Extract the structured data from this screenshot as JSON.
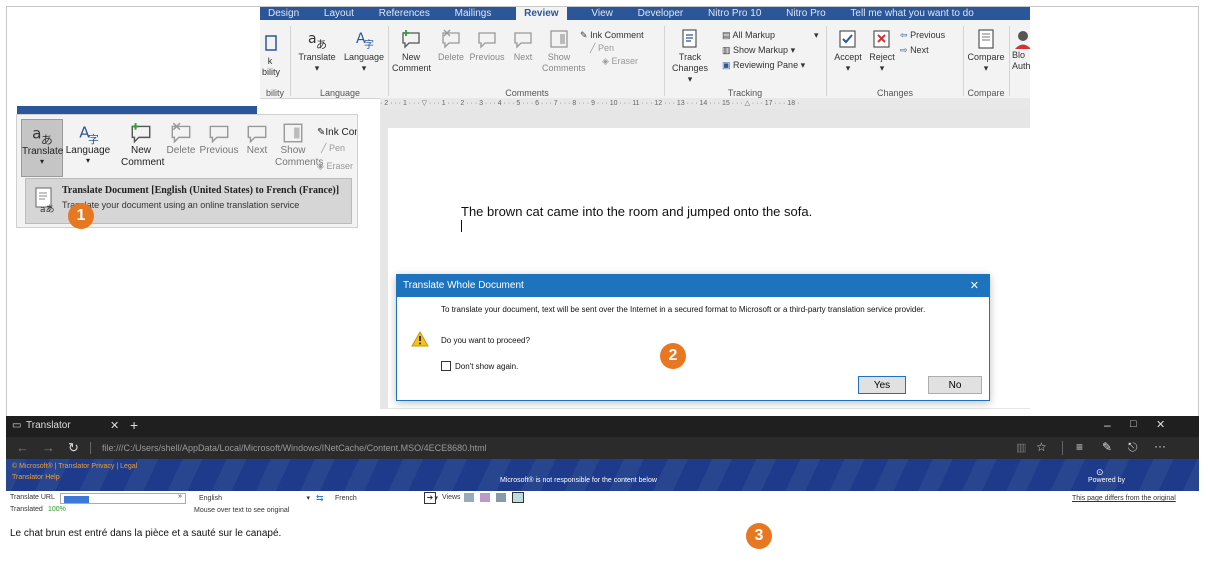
{
  "word": {
    "tabs": [
      "Design",
      "Layout",
      "References",
      "Mailings",
      "Review",
      "View",
      "Developer",
      "Nitro Pro 10",
      "Nitro Pro",
      "Tell me what you want to do"
    ],
    "active_tab": "Review",
    "ribbon": {
      "partial_left_top": "k",
      "partial_left_mid": "bility",
      "partial_left_group": "bility",
      "translate": "Translate",
      "language": "Language",
      "language_group": "Language",
      "new_comment_1": "New",
      "new_comment_2": "Comment",
      "delete": "Delete",
      "previous": "Previous",
      "next": "Next",
      "show_comments_1": "Show",
      "show_comments_2": "Comments",
      "ink_comment": "Ink Comment",
      "pen": "Pen",
      "eraser": "Eraser",
      "comments_group": "Comments",
      "track_changes_1": "Track",
      "track_changes_2": "Changes",
      "all_markup": "All Markup",
      "show_markup": "Show Markup",
      "reviewing_pane": "Reviewing Pane",
      "tracking_group": "Tracking",
      "accept": "Accept",
      "reject": "Reject",
      "previous_change": "Previous",
      "next_change": "Next",
      "changes_group": "Changes",
      "compare": "Compare",
      "compare_group": "Compare",
      "block_1": "Blo",
      "block_2": "Auth"
    },
    "ruler": "· 2 · · · 1 · · · ▽ · · · 1 · · · 2 · · · 3 · · · 4 · · · 5 · · · 6 · · · 7 · · · 8 · · · 9 · · · 10 · · · 11 · · · 12 · · · 13 · · · 14 · · · 15 · · · △ · · · 17 · · · 18 ·",
    "document_text": "The brown cat came into the room and jumped onto the sofa."
  },
  "inset": {
    "translate": "Translate",
    "language": "Language",
    "new_comment_1": "New",
    "new_comment_2": "Comment",
    "delete": "Delete",
    "previous": "Previous",
    "next": "Next",
    "show_1": "Show",
    "show_2": "Comments",
    "ink_comment": "Ink Com",
    "pen": "Pen",
    "eraser": "Eraser",
    "menu_title": "Translate Document [English (United States) to French (France)]",
    "menu_desc": "Translate your document using an online translation service"
  },
  "badges": [
    "1",
    "2",
    "3"
  ],
  "dialog": {
    "title": "Translate Whole Document",
    "close": "✕",
    "message": "To translate your document, text will be sent over the Internet in a secured format to Microsoft or a third-party translation service provider.",
    "question": "Do you want to proceed?",
    "dont_show": "Don't show again.",
    "yes": "Yes",
    "no": "No"
  },
  "browser": {
    "tab_title": "Translator",
    "tab_close": "✕",
    "new_tab": "+",
    "url": "file:///C:/Users/shell/AppData/Local/Microsoft/Windows/INetCache/Content.MSO/4ECE8680.html",
    "banner_left_1": "© Microsoft®  |  Translator Privacy  |  Legal",
    "banner_left_2": "Translator Help",
    "banner_center": "Microsoft® is not responsible for the content below",
    "banner_right": "Powered by",
    "translate_url_label": "Translate URL",
    "translated_label": "Translated",
    "translated_pct": "100%",
    "from_lang": "English",
    "to_lang": "French",
    "views_label": "Views",
    "mouse_over": "Mouse over text to see original",
    "differs_link": "This page differs from the original",
    "translated_text": "Le chat brun est entré dans la pièce et a sauté sur le canapé."
  }
}
